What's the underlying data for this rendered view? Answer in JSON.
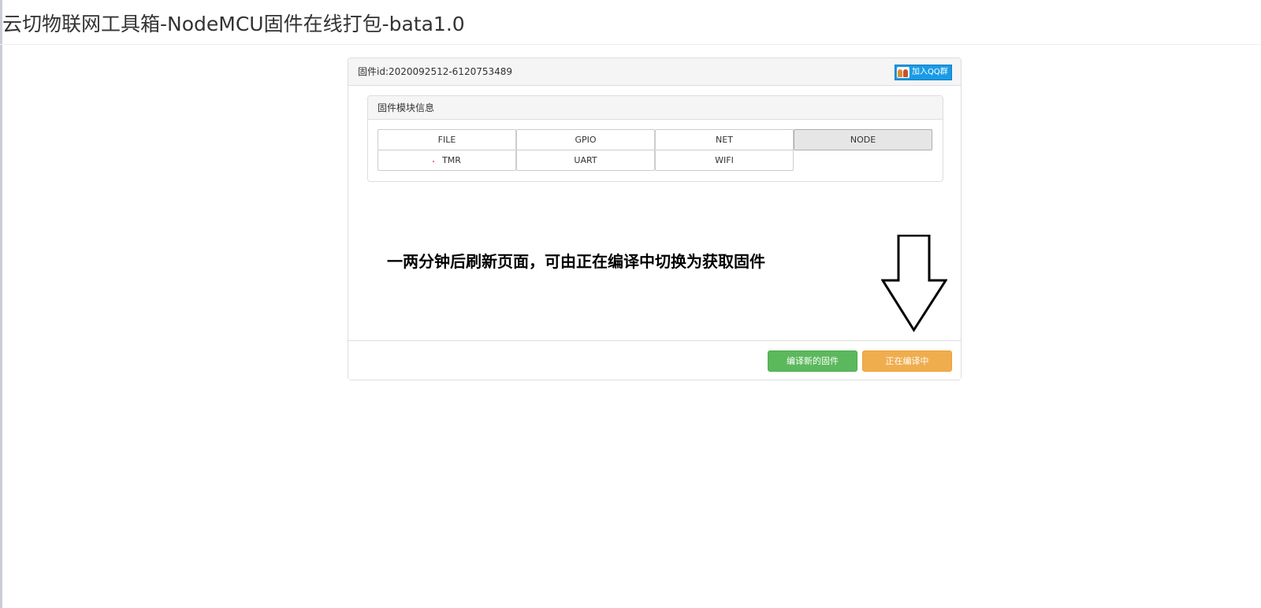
{
  "header": {
    "title": "云切物联网工具箱-NodeMCU固件在线打包-bata1.0"
  },
  "panel": {
    "firmware_id": "固件id:2020092512-6120753489",
    "qq_button_label": "加入QQ群",
    "module_info_title": "固件模块信息",
    "modules": [
      {
        "label": "FILE",
        "active": false
      },
      {
        "label": "GPIO",
        "active": false
      },
      {
        "label": "NET",
        "active": false
      },
      {
        "label": "NODE",
        "active": true
      },
      {
        "label": "TMR",
        "active": false
      },
      {
        "label": "UART",
        "active": false
      },
      {
        "label": "WIFI",
        "active": false
      }
    ],
    "annotation": "一两分钟后刷新页面，可由正在编译中切换为获取固件",
    "footer": {
      "compile_button": "编译新的固件",
      "status_button": "正在编译中"
    }
  },
  "colors": {
    "success": "#5cb85c",
    "warning": "#f0ad4e",
    "qq_blue": "#1a9be6"
  }
}
